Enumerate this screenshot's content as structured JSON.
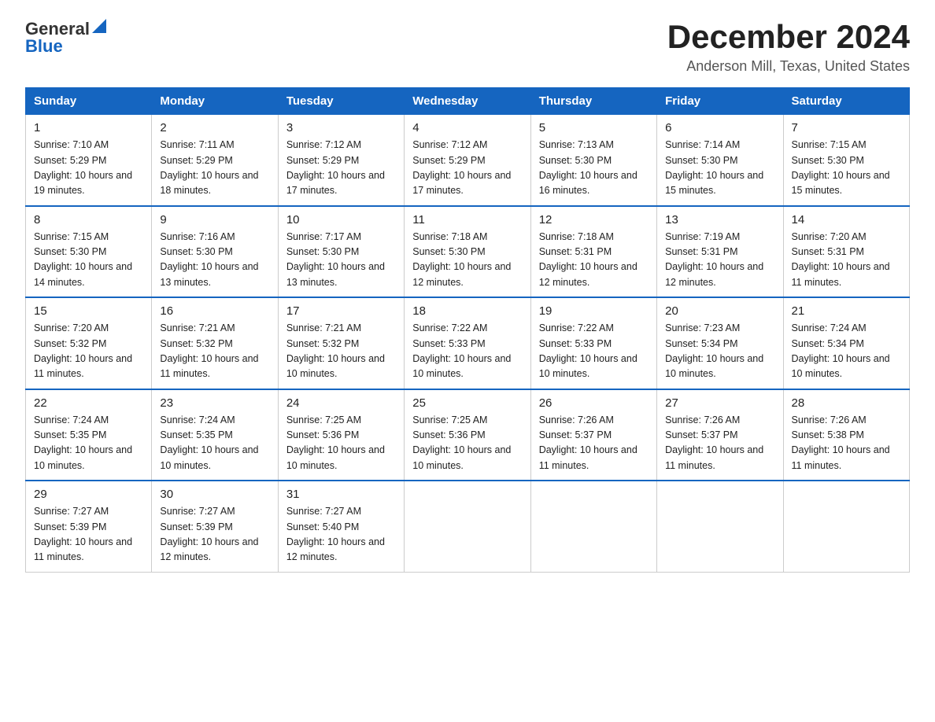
{
  "header": {
    "logo_general": "General",
    "logo_blue": "Blue",
    "title": "December 2024",
    "location": "Anderson Mill, Texas, United States"
  },
  "days_of_week": [
    "Sunday",
    "Monday",
    "Tuesday",
    "Wednesday",
    "Thursday",
    "Friday",
    "Saturday"
  ],
  "weeks": [
    [
      {
        "day": "1",
        "sunrise": "7:10 AM",
        "sunset": "5:29 PM",
        "daylight": "10 hours and 19 minutes."
      },
      {
        "day": "2",
        "sunrise": "7:11 AM",
        "sunset": "5:29 PM",
        "daylight": "10 hours and 18 minutes."
      },
      {
        "day": "3",
        "sunrise": "7:12 AM",
        "sunset": "5:29 PM",
        "daylight": "10 hours and 17 minutes."
      },
      {
        "day": "4",
        "sunrise": "7:12 AM",
        "sunset": "5:29 PM",
        "daylight": "10 hours and 17 minutes."
      },
      {
        "day": "5",
        "sunrise": "7:13 AM",
        "sunset": "5:30 PM",
        "daylight": "10 hours and 16 minutes."
      },
      {
        "day": "6",
        "sunrise": "7:14 AM",
        "sunset": "5:30 PM",
        "daylight": "10 hours and 15 minutes."
      },
      {
        "day": "7",
        "sunrise": "7:15 AM",
        "sunset": "5:30 PM",
        "daylight": "10 hours and 15 minutes."
      }
    ],
    [
      {
        "day": "8",
        "sunrise": "7:15 AM",
        "sunset": "5:30 PM",
        "daylight": "10 hours and 14 minutes."
      },
      {
        "day": "9",
        "sunrise": "7:16 AM",
        "sunset": "5:30 PM",
        "daylight": "10 hours and 13 minutes."
      },
      {
        "day": "10",
        "sunrise": "7:17 AM",
        "sunset": "5:30 PM",
        "daylight": "10 hours and 13 minutes."
      },
      {
        "day": "11",
        "sunrise": "7:18 AM",
        "sunset": "5:30 PM",
        "daylight": "10 hours and 12 minutes."
      },
      {
        "day": "12",
        "sunrise": "7:18 AM",
        "sunset": "5:31 PM",
        "daylight": "10 hours and 12 minutes."
      },
      {
        "day": "13",
        "sunrise": "7:19 AM",
        "sunset": "5:31 PM",
        "daylight": "10 hours and 12 minutes."
      },
      {
        "day": "14",
        "sunrise": "7:20 AM",
        "sunset": "5:31 PM",
        "daylight": "10 hours and 11 minutes."
      }
    ],
    [
      {
        "day": "15",
        "sunrise": "7:20 AM",
        "sunset": "5:32 PM",
        "daylight": "10 hours and 11 minutes."
      },
      {
        "day": "16",
        "sunrise": "7:21 AM",
        "sunset": "5:32 PM",
        "daylight": "10 hours and 11 minutes."
      },
      {
        "day": "17",
        "sunrise": "7:21 AM",
        "sunset": "5:32 PM",
        "daylight": "10 hours and 10 minutes."
      },
      {
        "day": "18",
        "sunrise": "7:22 AM",
        "sunset": "5:33 PM",
        "daylight": "10 hours and 10 minutes."
      },
      {
        "day": "19",
        "sunrise": "7:22 AM",
        "sunset": "5:33 PM",
        "daylight": "10 hours and 10 minutes."
      },
      {
        "day": "20",
        "sunrise": "7:23 AM",
        "sunset": "5:34 PM",
        "daylight": "10 hours and 10 minutes."
      },
      {
        "day": "21",
        "sunrise": "7:24 AM",
        "sunset": "5:34 PM",
        "daylight": "10 hours and 10 minutes."
      }
    ],
    [
      {
        "day": "22",
        "sunrise": "7:24 AM",
        "sunset": "5:35 PM",
        "daylight": "10 hours and 10 minutes."
      },
      {
        "day": "23",
        "sunrise": "7:24 AM",
        "sunset": "5:35 PM",
        "daylight": "10 hours and 10 minutes."
      },
      {
        "day": "24",
        "sunrise": "7:25 AM",
        "sunset": "5:36 PM",
        "daylight": "10 hours and 10 minutes."
      },
      {
        "day": "25",
        "sunrise": "7:25 AM",
        "sunset": "5:36 PM",
        "daylight": "10 hours and 10 minutes."
      },
      {
        "day": "26",
        "sunrise": "7:26 AM",
        "sunset": "5:37 PM",
        "daylight": "10 hours and 11 minutes."
      },
      {
        "day": "27",
        "sunrise": "7:26 AM",
        "sunset": "5:37 PM",
        "daylight": "10 hours and 11 minutes."
      },
      {
        "day": "28",
        "sunrise": "7:26 AM",
        "sunset": "5:38 PM",
        "daylight": "10 hours and 11 minutes."
      }
    ],
    [
      {
        "day": "29",
        "sunrise": "7:27 AM",
        "sunset": "5:39 PM",
        "daylight": "10 hours and 11 minutes."
      },
      {
        "day": "30",
        "sunrise": "7:27 AM",
        "sunset": "5:39 PM",
        "daylight": "10 hours and 12 minutes."
      },
      {
        "day": "31",
        "sunrise": "7:27 AM",
        "sunset": "5:40 PM",
        "daylight": "10 hours and 12 minutes."
      },
      null,
      null,
      null,
      null
    ]
  ],
  "labels": {
    "sunrise": "Sunrise:",
    "sunset": "Sunset:",
    "daylight": "Daylight:"
  }
}
